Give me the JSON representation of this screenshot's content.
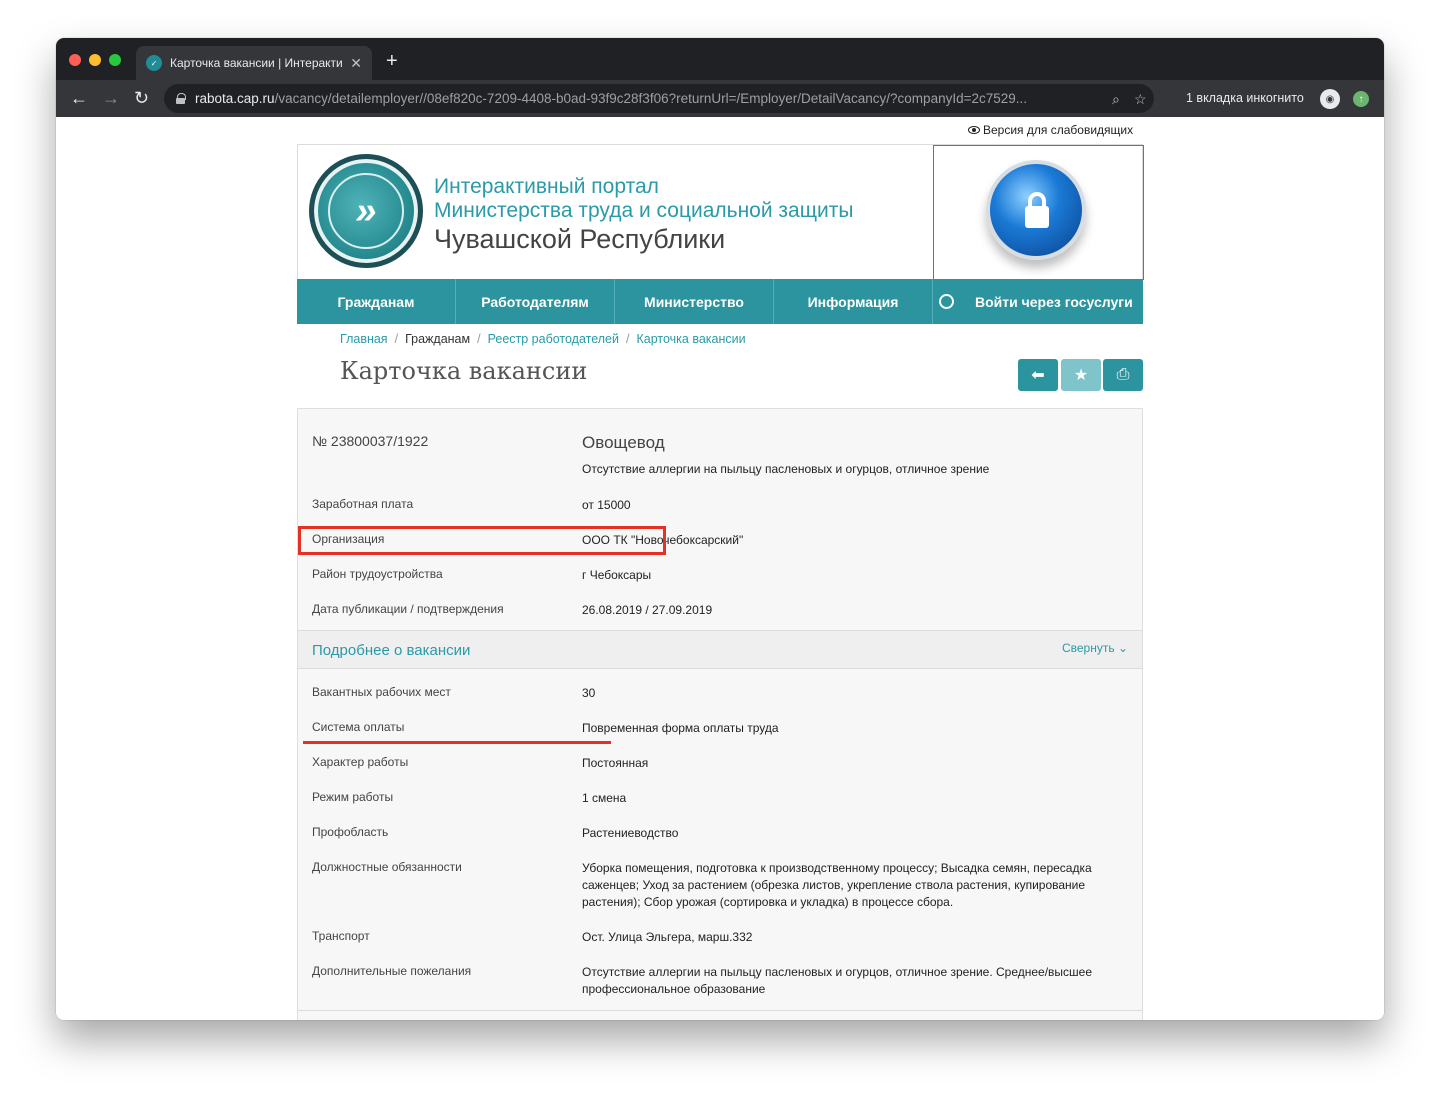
{
  "browser": {
    "tab_title": "Карточка вакансии | Интеракти",
    "url_host": "rabota.cap.ru",
    "url_path": "/vacancy/detailemployer//08ef820c-7209-4408-b0ad-93f9c28f3f06?returnUrl=/Employer/DetailVacancy/?companyId=2c7529...",
    "incognito_label": "1 вкладка инкогнито"
  },
  "site": {
    "a11y_link": "Версия для слабовидящих",
    "title_line1": "Интерактивный портал",
    "title_line2": "Министерства труда и социальной защиты",
    "title_line3": "Чувашской Республики"
  },
  "menu": {
    "items": [
      "Гражданам",
      "Работодателям",
      "Министерство",
      "Информация"
    ],
    "gosuslugi": "Войти через госуслуги"
  },
  "breadcrumb": {
    "home": "Главная",
    "citizens": "Гражданам",
    "registry": "Реестр работодателей",
    "current": "Карточка вакансии"
  },
  "page_title": "Карточка вакансии",
  "vacancy": {
    "number": "№ 23800037/1922",
    "title": "Овощевод",
    "description": "Отсутствие аллергии на пыльцу пасленовых и огурцов, отличное зрение",
    "salary_label": "Заработная плата",
    "salary_value": "от 15000",
    "org_label": "Организация",
    "org_value": "ООО ТК \"Новочебоксарский\"",
    "district_label": "Район трудоустройства",
    "district_value": "г Чебоксары",
    "date_label": "Дата публикации / подтверждения",
    "date_value": "26.08.2019 / 27.09.2019"
  },
  "details": {
    "section_title": "Подробнее о вакансии",
    "collapse_label": "Свернуть",
    "rows": [
      {
        "label": "Вакантных рабочих мест",
        "value": "30"
      },
      {
        "label": "Система оплаты",
        "value": "Повременная форма оплаты труда"
      },
      {
        "label": "Характер работы",
        "value": "Постоянная"
      },
      {
        "label": "Режим работы",
        "value": "1 смена"
      },
      {
        "label": "Профобласть",
        "value": "Растениеводство"
      },
      {
        "label": "Должностные обязанности",
        "value": "Уборка помещения, подготовка к производственному процессу; Высадка семян, пересадка саженцев; Уход за растением (обрезка листов, укрепление ствола растения, купирование растения); Сбор урожая (сортировка и укладка) в процессе сбора."
      },
      {
        "label": "Транспорт",
        "value": "Ост. Улица Эльгера, марш.332"
      },
      {
        "label": "Дополнительные пожелания",
        "value": "Отсутствие аллергии на пыльцу пасленовых и огурцов, отличное зрение. Среднее/высшее профессиональное образование"
      }
    ]
  }
}
